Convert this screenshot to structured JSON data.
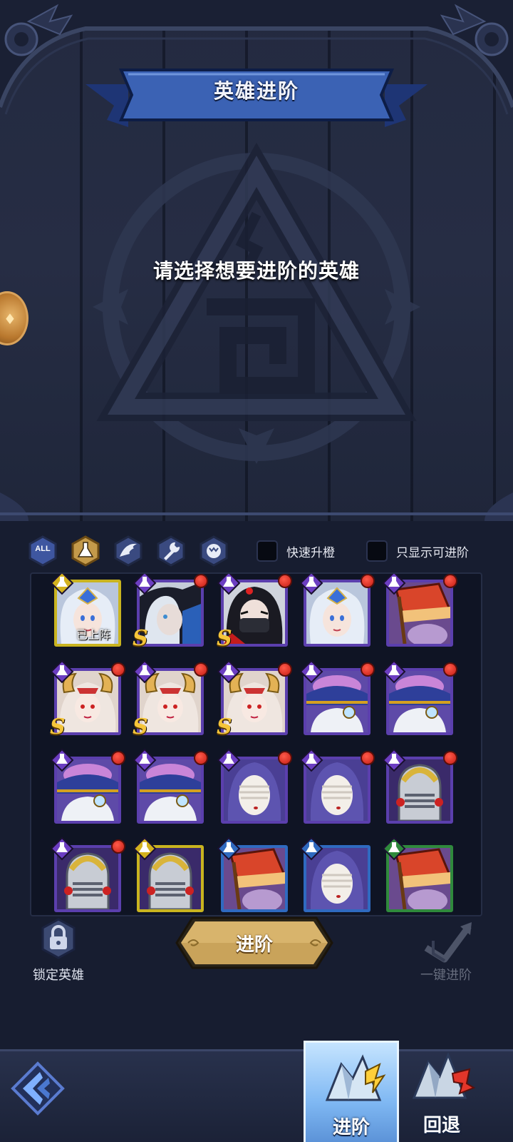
{
  "header": {
    "title": "英雄进阶"
  },
  "stage": {
    "prompt": "请选择想要进阶的英雄"
  },
  "filters": [
    {
      "name": "all",
      "label": "ALL",
      "icon": "all-filter-icon"
    },
    {
      "name": "flask",
      "label": "",
      "icon": "flask-filter-icon"
    },
    {
      "name": "wing",
      "label": "",
      "icon": "wing-filter-icon"
    },
    {
      "name": "wrench",
      "label": "",
      "icon": "wrench-filter-icon"
    },
    {
      "name": "beast",
      "label": "",
      "icon": "beast-filter-icon"
    }
  ],
  "toggles": {
    "quick_orange": {
      "label": "快速升橙",
      "checked": false
    },
    "only_advanceable": {
      "label": "只显示可进阶",
      "checked": false
    }
  },
  "heroes": [
    {
      "portrait": "silver-crown-lady",
      "frame": "#c9b41f",
      "class_icon": "flask",
      "class_color": "#d4b21e",
      "dot": false,
      "s": false,
      "status": "已上阵"
    },
    {
      "portrait": "split-face-vampire",
      "frame": "#5b3fad",
      "class_icon": "flask",
      "class_color": "#6c3ec2",
      "dot": true,
      "s": true,
      "status": ""
    },
    {
      "portrait": "masked-ninja-girl",
      "frame": "#5b3fad",
      "class_icon": "flask",
      "class_color": "#6c3ec2",
      "dot": true,
      "s": true,
      "status": ""
    },
    {
      "portrait": "silver-crown-lady",
      "frame": "#5b3fad",
      "class_icon": "flask",
      "class_color": "#6c3ec2",
      "dot": true,
      "s": false,
      "status": ""
    },
    {
      "portrait": "red-hat-ghost",
      "frame": "#5b3fad",
      "class_icon": "flask",
      "class_color": "#6c3ec2",
      "dot": true,
      "s": false,
      "status": ""
    },
    {
      "portrait": "horned-priestess",
      "frame": "#5b3fad",
      "class_icon": "flask",
      "class_color": "#6c3ec2",
      "dot": true,
      "s": true,
      "status": ""
    },
    {
      "portrait": "horned-priestess",
      "frame": "#5b3fad",
      "class_icon": "flask",
      "class_color": "#6c3ec2",
      "dot": true,
      "s": true,
      "status": ""
    },
    {
      "portrait": "horned-priestess",
      "frame": "#5b3fad",
      "class_icon": "flask",
      "class_color": "#6c3ec2",
      "dot": true,
      "s": true,
      "status": ""
    },
    {
      "portrait": "brain-hat-scholar",
      "frame": "#5b3fad",
      "class_icon": "flask",
      "class_color": "#6c3ec2",
      "dot": true,
      "s": false,
      "status": ""
    },
    {
      "portrait": "brain-hat-scholar",
      "frame": "#5b3fad",
      "class_icon": "flask",
      "class_color": "#6c3ec2",
      "dot": true,
      "s": false,
      "status": ""
    },
    {
      "portrait": "brain-hat-scholar",
      "frame": "#5b3fad",
      "class_icon": "flask",
      "class_color": "#6c3ec2",
      "dot": true,
      "s": false,
      "status": ""
    },
    {
      "portrait": "brain-hat-scholar",
      "frame": "#5b3fad",
      "class_icon": "flask",
      "class_color": "#6c3ec2",
      "dot": true,
      "s": false,
      "status": ""
    },
    {
      "portrait": "bandaged-nun",
      "frame": "#5b3fad",
      "class_icon": "flask",
      "class_color": "#6c3ec2",
      "dot": true,
      "s": false,
      "status": ""
    },
    {
      "portrait": "bandaged-nun",
      "frame": "#5b3fad",
      "class_icon": "flask",
      "class_color": "#6c3ec2",
      "dot": true,
      "s": false,
      "status": ""
    },
    {
      "portrait": "gold-knight-helmet",
      "frame": "#5b3fad",
      "class_icon": "flask",
      "class_color": "#6c3ec2",
      "dot": true,
      "s": false,
      "status": ""
    },
    {
      "portrait": "gold-knight-helmet",
      "frame": "#5b3fad",
      "class_icon": "flask",
      "class_color": "#6c3ec2",
      "dot": true,
      "s": false,
      "status": ""
    },
    {
      "portrait": "gold-knight-helmet",
      "frame": "#c9b41f",
      "class_icon": "flask",
      "class_color": "#d4b21e",
      "dot": false,
      "s": false,
      "status": ""
    },
    {
      "portrait": "red-hat-ghost",
      "frame": "#2f6ac0",
      "class_icon": "flask",
      "class_color": "#2f6ac0",
      "dot": false,
      "s": false,
      "status": ""
    },
    {
      "portrait": "bandaged-nun",
      "frame": "#2f6ac0",
      "class_icon": "flask",
      "class_color": "#2f6ac0",
      "dot": false,
      "s": false,
      "status": ""
    },
    {
      "portrait": "red-hat-ghost",
      "frame": "#2f8a3c",
      "class_icon": "flask",
      "class_color": "#2f8a3c",
      "dot": false,
      "s": false,
      "status": ""
    }
  ],
  "controls": {
    "lock_label": "锁定英雄",
    "advance_label": "进阶",
    "onekey_label": "一键进阶"
  },
  "nav": {
    "tabs": [
      {
        "label": "进阶",
        "active": true,
        "icon": "advance-crystal-icon"
      },
      {
        "label": "回退",
        "active": false,
        "icon": "revert-crystal-icon"
      }
    ],
    "back_icon": "back-arrow-icon"
  },
  "colors": {
    "accent_gold": "#c9a35a",
    "banner_blue": "#3a5aa6",
    "bg_dark": "#171d30",
    "badge_red": "#d8261b"
  }
}
